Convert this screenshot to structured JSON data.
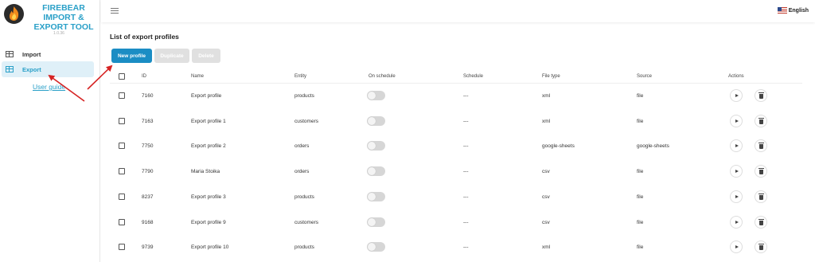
{
  "app": {
    "brand": "FIREBEAR\nIMPORT &\nEXPORT TOOL",
    "version": "1.0.36",
    "accent": "#2aa0c8",
    "button_color": "#1b8dc4"
  },
  "sidebar": {
    "items": [
      {
        "label": "Import",
        "icon": "table-icon"
      },
      {
        "label": "Export",
        "icon": "table-icon",
        "active": true
      }
    ],
    "user_guide": "User guide"
  },
  "topbar": {
    "language": "English",
    "flag": "us-flag-icon"
  },
  "main": {
    "title": "List of export profiles",
    "buttons": {
      "new": "New profile",
      "duplicate": "Duplicate",
      "delete": "Delete"
    },
    "columns": [
      "ID",
      "Name",
      "Entity",
      "On schedule",
      "Schedule",
      "File type",
      "Source",
      "Actions"
    ],
    "rows": [
      {
        "id": "7160",
        "name": "Export profile",
        "entity": "products",
        "schedule": "---",
        "file_type": "xml",
        "source": "file"
      },
      {
        "id": "7163",
        "name": "Export profile 1",
        "entity": "customers",
        "schedule": "---",
        "file_type": "xml",
        "source": "file"
      },
      {
        "id": "7750",
        "name": "Export profile 2",
        "entity": "orders",
        "schedule": "---",
        "file_type": "google-sheets",
        "source": "google-sheets"
      },
      {
        "id": "7790",
        "name": "Maria Stoika",
        "entity": "orders",
        "schedule": "---",
        "file_type": "csv",
        "source": "file"
      },
      {
        "id": "8237",
        "name": "Export profile 3",
        "entity": "products",
        "schedule": "---",
        "file_type": "csv",
        "source": "file"
      },
      {
        "id": "9168",
        "name": "Export profile 9",
        "entity": "customers",
        "schedule": "---",
        "file_type": "csv",
        "source": "file"
      },
      {
        "id": "9739",
        "name": "Export profile 10",
        "entity": "products",
        "schedule": "---",
        "file_type": "xml",
        "source": "file"
      }
    ]
  },
  "annotation_color": "#d62424"
}
